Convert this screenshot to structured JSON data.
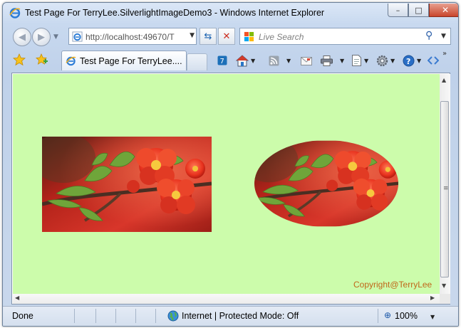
{
  "window": {
    "title": "Test Page For TerryLee.SilverlightImageDemo3 - Windows Internet Explorer",
    "min_icon": "minimize-icon",
    "max_icon": "maximize-icon",
    "close_icon": "close-icon"
  },
  "address_bar": {
    "url": "http://localhost:49670/T",
    "refresh_icon": "refresh-icon",
    "stop_icon": "stop-icon"
  },
  "search": {
    "placeholder": "Live Search",
    "search_icon": "magnifier-icon"
  },
  "tabs": [
    {
      "label": "Test Page For TerryLee....",
      "active": true
    }
  ],
  "command_bar": {
    "items": [
      "home-icon",
      "feeds-icon",
      "mail-icon",
      "print-icon",
      "page-icon",
      "tools-icon",
      "help-icon",
      "research-icon"
    ],
    "overflow": "»"
  },
  "page": {
    "background": "#ccfcab",
    "copyright": "Copyright@TerryLee",
    "copyright_color": "#c0661a",
    "images": [
      {
        "subject": "red flowering quince blossoms on a branch",
        "shape": "rectangle"
      },
      {
        "subject": "red flowering quince blossoms on a branch",
        "shape": "ellipse"
      }
    ]
  },
  "status_bar": {
    "status": "Done",
    "zone": "Internet | Protected Mode: Off",
    "zoom": "100%"
  }
}
